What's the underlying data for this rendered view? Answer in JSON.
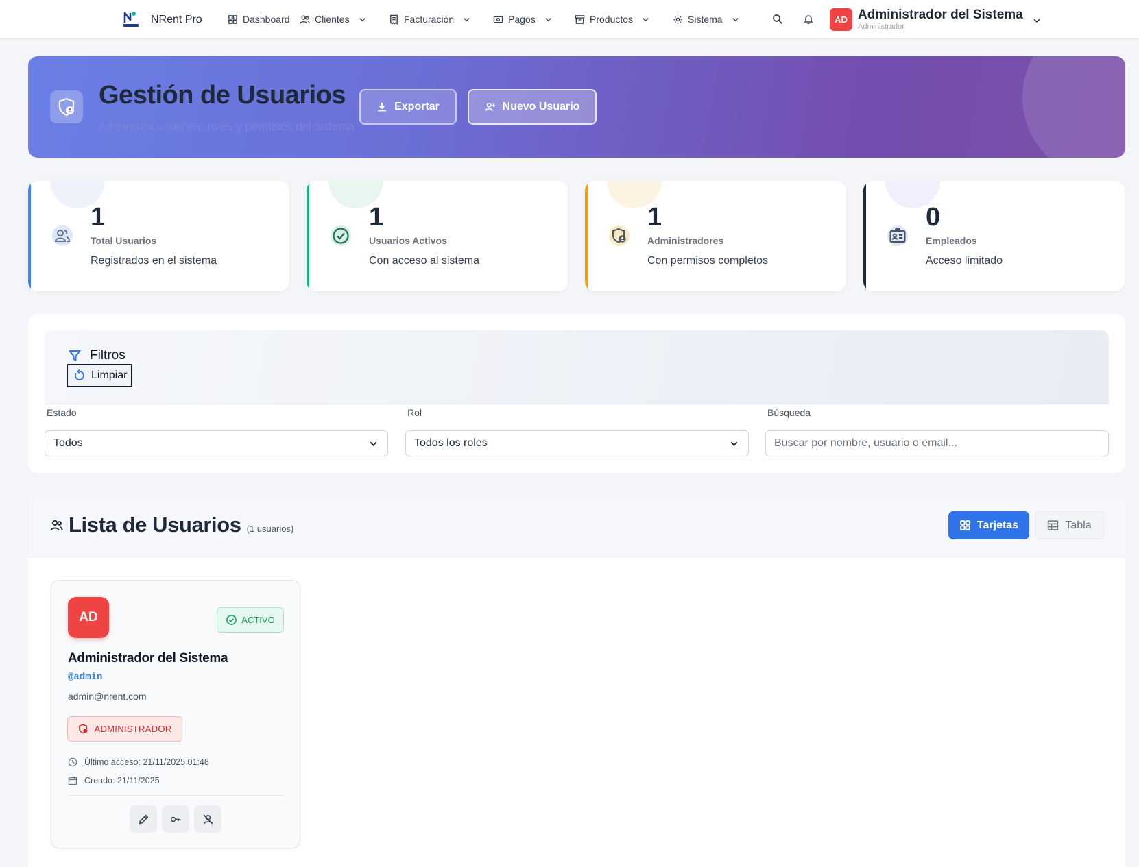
{
  "navbar": {
    "brand": "NRent Pro",
    "items": [
      {
        "label": "Dashboard"
      },
      {
        "label": "Clientes"
      },
      {
        "label": "Facturación"
      },
      {
        "label": "Pagos"
      },
      {
        "label": "Productos"
      },
      {
        "label": "Sistema"
      }
    ],
    "user": {
      "initials": "AD",
      "name": "Administrador del Sistema",
      "role": "Administrador"
    }
  },
  "hero": {
    "title": "Gestión de Usuarios",
    "subtitle": "Administra usuarios, roles y permisos del sistema",
    "export_label": "Exportar",
    "new_label": "Nuevo Usuario"
  },
  "stats": [
    {
      "value": "1",
      "label": "Total Usuarios",
      "desc": "Registrados en el sistema",
      "color": "#3b82f6"
    },
    {
      "value": "1",
      "label": "Usuarios Activos",
      "desc": "Con acceso al sistema",
      "color": "#10b981"
    },
    {
      "value": "1",
      "label": "Administradores",
      "desc": "Con permisos completos",
      "color": "#f59e0b"
    },
    {
      "value": "0",
      "label": "Empleados",
      "desc": "Acceso limitado",
      "color": "#1f2937"
    }
  ],
  "filters": {
    "title": "Filtros",
    "clear_label": "Limpiar",
    "estado": {
      "label": "Estado",
      "value": "Todos"
    },
    "rol": {
      "label": "Rol",
      "value": "Todos los roles"
    },
    "busqueda": {
      "label": "Búsqueda",
      "placeholder": "Buscar por nombre, usuario o email..."
    }
  },
  "list": {
    "title": "Lista de Usuarios",
    "count": "(1 usuarios)",
    "cards_label": "Tarjetas",
    "table_label": "Tabla",
    "users": [
      {
        "initials": "AD",
        "status": "ACTIVO",
        "name": "Administrador del Sistema",
        "username": "@admin",
        "email": "admin@nrent.com",
        "role": "ADMINISTRADOR",
        "last_access": "Último acceso: 21/11/2025 01:48",
        "created": "Creado: 21/11/2025"
      }
    ]
  },
  "colors": {
    "primary": "#2f74e8",
    "danger": "#ef4444",
    "success": "#0f9f5f"
  }
}
